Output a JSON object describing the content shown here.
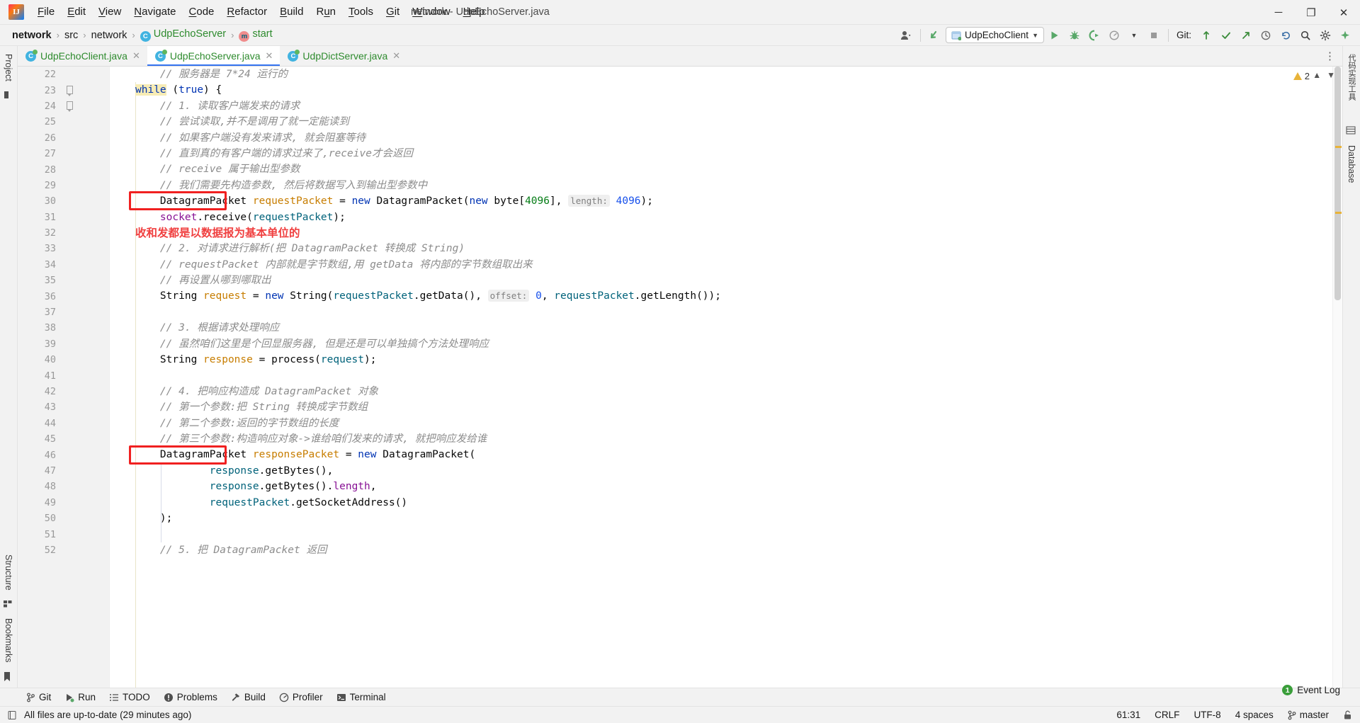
{
  "window": {
    "title": "network - UdpEchoServer.java",
    "minimize": "─",
    "maximize": "❐",
    "close": "✕"
  },
  "menu": [
    {
      "label": "File",
      "mnemonic": "F"
    },
    {
      "label": "Edit",
      "mnemonic": "E"
    },
    {
      "label": "View",
      "mnemonic": "V"
    },
    {
      "label": "Navigate",
      "mnemonic": "N"
    },
    {
      "label": "Code",
      "mnemonic": "C"
    },
    {
      "label": "Refactor",
      "mnemonic": "R"
    },
    {
      "label": "Build",
      "mnemonic": "B"
    },
    {
      "label": "Run",
      "mnemonic": "u"
    },
    {
      "label": "Tools",
      "mnemonic": "T"
    },
    {
      "label": "Git",
      "mnemonic": "G"
    },
    {
      "label": "Window",
      "mnemonic": "W"
    },
    {
      "label": "Help",
      "mnemonic": "H"
    }
  ],
  "breadcrumbs": [
    {
      "label": "network",
      "style": "bold"
    },
    {
      "label": "src",
      "style": "plain"
    },
    {
      "label": "network",
      "style": "plain"
    },
    {
      "label": "UdpEchoServer",
      "style": "green",
      "icon": "class-icon",
      "icon_letter": "C"
    },
    {
      "label": "start",
      "style": "green",
      "icon": "method-icon",
      "icon_letter": "m"
    }
  ],
  "toolbar": {
    "run_configuration": "UdpEchoClient",
    "git_label": "Git:",
    "icons": [
      "user-icon",
      "updated-icon",
      "run-icon",
      "debug-icon",
      "run-coverage-icon",
      "profiler-icon",
      "stop-icon",
      "git-update-icon",
      "git-commit-icon",
      "git-push-icon",
      "git-history-icon",
      "git-rollback-icon",
      "search-icon",
      "settings-icon",
      "assistant-icon"
    ]
  },
  "tabs": [
    {
      "label": "UdpEchoClient.java",
      "active": false
    },
    {
      "label": "UdpEchoServer.java",
      "active": true
    },
    {
      "label": "UdpDictServer.java",
      "active": false
    }
  ],
  "left_strip": [
    {
      "label": "Project",
      "name": "tool-project"
    },
    {
      "label": "Structure",
      "name": "tool-structure"
    },
    {
      "label": "Bookmarks",
      "name": "tool-bookmarks"
    }
  ],
  "right_strip": [
    {
      "label": "代码实现工具",
      "name": "tool-code-impl"
    },
    {
      "label": "Database",
      "name": "tool-database"
    }
  ],
  "editor": {
    "first_line": 22,
    "inspection_warnings": "2",
    "lines": [
      {
        "n": 22,
        "fold": false,
        "tokens": [
          {
            "t": "    ",
            "c": "pln"
          },
          {
            "t": "// 服务器是 7*24 运行的",
            "c": "cmt"
          }
        ]
      },
      {
        "n": 23,
        "fold": true,
        "tokens": [
          {
            "t": "",
            "c": "pln"
          },
          {
            "t": "while",
            "c": "k kw-hl"
          },
          {
            "t": " (",
            "c": "pln"
          },
          {
            "t": "true",
            "c": "k"
          },
          {
            "t": ") {",
            "c": "pln"
          }
        ]
      },
      {
        "n": 24,
        "fold": true,
        "tokens": [
          {
            "t": "    ",
            "c": "pln"
          },
          {
            "t": "// 1. 读取客户端发来的请求",
            "c": "cmt"
          }
        ]
      },
      {
        "n": 25,
        "fold": false,
        "tokens": [
          {
            "t": "    ",
            "c": "pln"
          },
          {
            "t": "// 尝试读取,并不是调用了就一定能读到",
            "c": "cmt"
          }
        ]
      },
      {
        "n": 26,
        "fold": false,
        "tokens": [
          {
            "t": "    ",
            "c": "pln"
          },
          {
            "t": "// 如果客户端没有发来请求, 就会阻塞等待",
            "c": "cmt"
          }
        ]
      },
      {
        "n": 27,
        "fold": false,
        "tokens": [
          {
            "t": "    ",
            "c": "pln"
          },
          {
            "t": "// 直到真的有客户端的请求过来了,receive才会返回",
            "c": "cmt"
          }
        ]
      },
      {
        "n": 28,
        "fold": false,
        "tokens": [
          {
            "t": "    ",
            "c": "pln"
          },
          {
            "t": "// receive 属于输出型参数",
            "c": "cmt"
          }
        ]
      },
      {
        "n": 29,
        "fold": false,
        "tokens": [
          {
            "t": "    ",
            "c": "pln"
          },
          {
            "t": "// 我们需要先构造参数, 然后将数据写入到输出型参数中",
            "c": "cmt"
          }
        ]
      },
      {
        "n": 30,
        "fold": false,
        "tokens": [
          {
            "t": "    DatagramPacket ",
            "c": "pln"
          },
          {
            "t": "requestPacket",
            "c": "var"
          },
          {
            "t": " = ",
            "c": "pln"
          },
          {
            "t": "new",
            "c": "k"
          },
          {
            "t": " DatagramPacket(",
            "c": "pln"
          },
          {
            "t": "new",
            "c": "k"
          },
          {
            "t": " byte[",
            "c": "pln"
          },
          {
            "t": "4096",
            "c": "s"
          },
          {
            "t": "], ",
            "c": "pln"
          },
          {
            "t": "length:",
            "c": "hint"
          },
          {
            "t": " ",
            "c": "pln"
          },
          {
            "t": "4096",
            "c": "n"
          },
          {
            "t": ");",
            "c": "pln"
          }
        ]
      },
      {
        "n": 31,
        "fold": false,
        "tokens": [
          {
            "t": "    ",
            "c": "pln"
          },
          {
            "t": "socket",
            "c": "fld"
          },
          {
            "t": ".receive(",
            "c": "pln"
          },
          {
            "t": "requestPacket",
            "c": "mth"
          },
          {
            "t": ");",
            "c": "pln"
          }
        ]
      },
      {
        "n": 32,
        "fold": false,
        "annotation": "收和发都是以数据报为基本单位的",
        "tokens": []
      },
      {
        "n": 33,
        "fold": false,
        "tokens": [
          {
            "t": "    ",
            "c": "pln"
          },
          {
            "t": "// 2. 对请求进行解析(把 DatagramPacket 转换成 String)",
            "c": "cmt"
          }
        ]
      },
      {
        "n": 34,
        "fold": false,
        "tokens": [
          {
            "t": "    ",
            "c": "pln"
          },
          {
            "t": "// requestPacket 内部就是字节数组,用 getData 将内部的字节数组取出来",
            "c": "cmt"
          }
        ]
      },
      {
        "n": 35,
        "fold": false,
        "tokens": [
          {
            "t": "    ",
            "c": "pln"
          },
          {
            "t": "// 再设置从哪到哪取出",
            "c": "cmt"
          }
        ]
      },
      {
        "n": 36,
        "fold": false,
        "tokens": [
          {
            "t": "    String ",
            "c": "pln"
          },
          {
            "t": "request",
            "c": "var"
          },
          {
            "t": " = ",
            "c": "pln"
          },
          {
            "t": "new",
            "c": "k"
          },
          {
            "t": " String(",
            "c": "pln"
          },
          {
            "t": "requestPacket",
            "c": "mth"
          },
          {
            "t": ".getData(), ",
            "c": "pln"
          },
          {
            "t": "offset:",
            "c": "hint"
          },
          {
            "t": " ",
            "c": "pln"
          },
          {
            "t": "0",
            "c": "n"
          },
          {
            "t": ", ",
            "c": "pln"
          },
          {
            "t": "requestPacket",
            "c": "mth"
          },
          {
            "t": ".getLength());",
            "c": "pln"
          }
        ]
      },
      {
        "n": 37,
        "fold": false,
        "tokens": []
      },
      {
        "n": 38,
        "fold": false,
        "tokens": [
          {
            "t": "    ",
            "c": "pln"
          },
          {
            "t": "// 3. 根据请求处理响应",
            "c": "cmt"
          }
        ]
      },
      {
        "n": 39,
        "fold": false,
        "tokens": [
          {
            "t": "    ",
            "c": "pln"
          },
          {
            "t": "// 虽然咱们这里是个回显服务器, 但是还是可以单独搞个方法处理响应",
            "c": "cmt"
          }
        ]
      },
      {
        "n": 40,
        "fold": false,
        "tokens": [
          {
            "t": "    String ",
            "c": "pln"
          },
          {
            "t": "response",
            "c": "var"
          },
          {
            "t": " = process(",
            "c": "pln"
          },
          {
            "t": "request",
            "c": "mth"
          },
          {
            "t": ");",
            "c": "pln"
          }
        ]
      },
      {
        "n": 41,
        "fold": false,
        "tokens": []
      },
      {
        "n": 42,
        "fold": false,
        "tokens": [
          {
            "t": "    ",
            "c": "pln"
          },
          {
            "t": "// 4. 把响应构造成 DatagramPacket 对象",
            "c": "cmt"
          }
        ]
      },
      {
        "n": 43,
        "fold": false,
        "tokens": [
          {
            "t": "    ",
            "c": "pln"
          },
          {
            "t": "// 第一个参数:把 String 转换成字节数组",
            "c": "cmt"
          }
        ]
      },
      {
        "n": 44,
        "fold": false,
        "tokens": [
          {
            "t": "    ",
            "c": "pln"
          },
          {
            "t": "// 第二个参数:返回的字节数组的长度",
            "c": "cmt"
          }
        ]
      },
      {
        "n": 45,
        "fold": false,
        "tokens": [
          {
            "t": "    ",
            "c": "pln"
          },
          {
            "t": "// 第三个参数:构造响应对象->谁给咱们发来的请求, 就把响应发给谁",
            "c": "cmt"
          }
        ]
      },
      {
        "n": 46,
        "fold": false,
        "tokens": [
          {
            "t": "    DatagramPacket ",
            "c": "pln"
          },
          {
            "t": "responsePacket",
            "c": "var"
          },
          {
            "t": " = ",
            "c": "pln"
          },
          {
            "t": "new",
            "c": "k"
          },
          {
            "t": " DatagramPacket(",
            "c": "pln"
          }
        ]
      },
      {
        "n": 47,
        "fold": false,
        "tokens": [
          {
            "t": "            ",
            "c": "pln"
          },
          {
            "t": "response",
            "c": "mth"
          },
          {
            "t": ".getBytes(),",
            "c": "pln"
          }
        ]
      },
      {
        "n": 48,
        "fold": false,
        "tokens": [
          {
            "t": "            ",
            "c": "pln"
          },
          {
            "t": "response",
            "c": "mth"
          },
          {
            "t": ".getBytes().",
            "c": "pln"
          },
          {
            "t": "length",
            "c": "fld"
          },
          {
            "t": ",",
            "c": "pln"
          }
        ]
      },
      {
        "n": 49,
        "fold": false,
        "tokens": [
          {
            "t": "            ",
            "c": "pln"
          },
          {
            "t": "requestPacket",
            "c": "mth"
          },
          {
            "t": ".getSocketAddress()",
            "c": "pln"
          }
        ]
      },
      {
        "n": 50,
        "fold": false,
        "tokens": [
          {
            "t": "    );",
            "c": "pln"
          }
        ]
      },
      {
        "n": 51,
        "fold": false,
        "tokens": []
      },
      {
        "n": 52,
        "fold": false,
        "tokens": [
          {
            "t": "    ",
            "c": "pln"
          },
          {
            "t": "// 5. 把 DatagramPacket 返回",
            "c": "cmt"
          }
        ]
      }
    ],
    "annotations": [
      {
        "name": "redbox-datagrampacket-request",
        "line": 30
      },
      {
        "name": "redbox-datagrampacket-response",
        "line": 46
      }
    ]
  },
  "bottom_tools": [
    {
      "label": "Git",
      "icon": "git-branch-icon"
    },
    {
      "label": "Run",
      "icon": "run-icon"
    },
    {
      "label": "TODO",
      "icon": "todo-list-icon"
    },
    {
      "label": "Problems",
      "icon": "problems-icon"
    },
    {
      "label": "Build",
      "icon": "build-hammer-icon"
    },
    {
      "label": "Profiler",
      "icon": "profiler-icon"
    },
    {
      "label": "Terminal",
      "icon": "terminal-icon"
    }
  ],
  "status": {
    "message": "All files are up-to-date (29 minutes ago)",
    "event_log": "Event Log",
    "event_count": "1",
    "caret": "61:31",
    "line_separator": "CRLF",
    "encoding": "UTF-8",
    "indent": "4 spaces",
    "branch": "master"
  },
  "colors": {
    "accent": "#3574f0",
    "annotation_red": "#f02020",
    "green_text": "#2e8b2e",
    "comment_gray": "#8c8c8c",
    "keyword_blue": "#0033b3"
  }
}
